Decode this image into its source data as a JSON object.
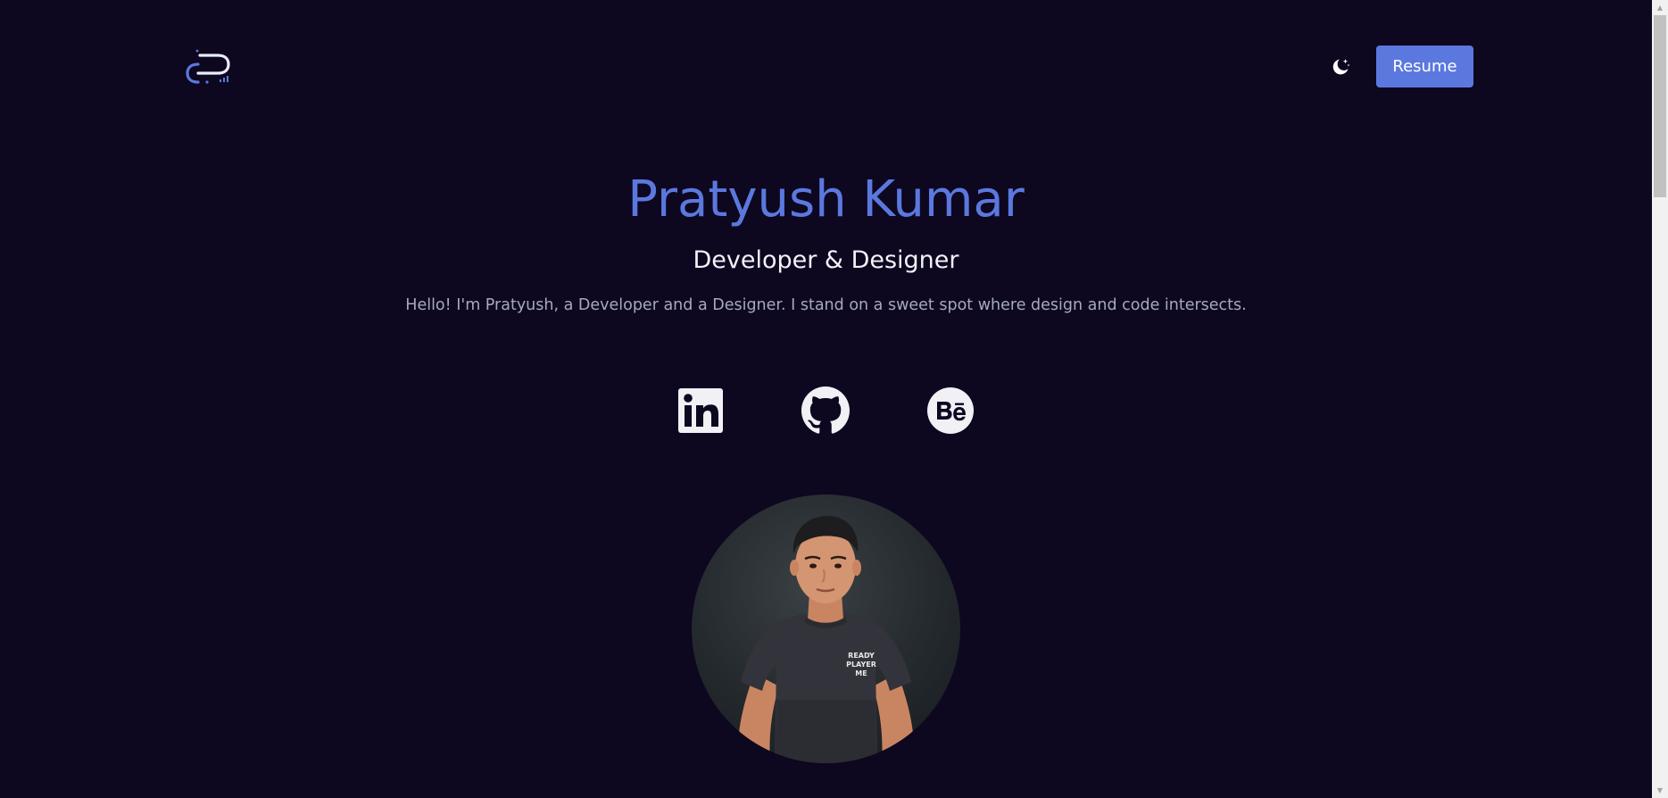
{
  "header": {
    "logo_icon": "pk-logo-icon",
    "theme_toggle_icon": "moon-stars-icon",
    "resume_label": "Resume"
  },
  "hero": {
    "name": "Pratyush Kumar",
    "role": "Developer & Designer",
    "intro": "Hello! I'm Pratyush, a Developer and a Designer. I stand on a sweet spot where design and code intersects."
  },
  "socials": [
    {
      "name": "LinkedIn",
      "icon": "linkedin-icon"
    },
    {
      "name": "GitHub",
      "icon": "github-icon"
    },
    {
      "name": "Behance",
      "icon": "behance-icon"
    }
  ],
  "avatar": {
    "shirt_text": [
      "READY",
      "PLAYER",
      "ME"
    ]
  },
  "colors": {
    "background": "#0d0720",
    "accent": "#5b78de",
    "heading_light": "#f2f2f7",
    "muted_text": "#a6a9bf",
    "icon_light": "#f0f0f5"
  }
}
